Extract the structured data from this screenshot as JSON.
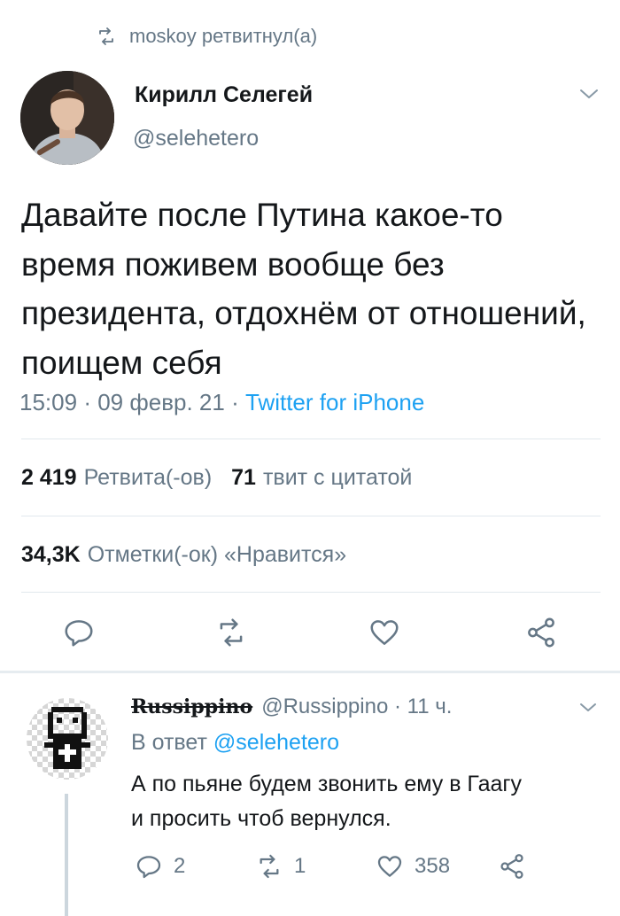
{
  "retweet_context": {
    "text": "moskoy ретвитнул(а)",
    "icon": "retweet-icon"
  },
  "tweet": {
    "author_name": "Кирилл Селегей",
    "author_handle": "@selehetero",
    "text": "Давайте после Путина какое-то время поживем вообще без президента, отдохнём от отношений, поищем себя",
    "time": "15:09",
    "date": "09 февр. 21",
    "source": "Twitter for iPhone",
    "retweets_count": "2 419",
    "retweets_label": "Ретвита(-ов)",
    "quotes_count": "71",
    "quotes_label": "твит с цитатой",
    "likes_count": "34,3K",
    "likes_label": "Отметки(-ок) «Нравится»",
    "actions": [
      "reply-icon",
      "retweet-icon",
      "like-icon",
      "share-icon"
    ]
  },
  "reply": {
    "author_name": "Russippino",
    "author_handle": "@Russippino",
    "time_ago": "11 ч.",
    "reply_prefix": "В ответ",
    "reply_to": "@selehetero",
    "text_line1": "А по пьяне будем звонить ему в Гаагу",
    "text_line2": "и просить чтоб вернулся.",
    "replies_count": "2",
    "retweets_count": "1",
    "likes_count": "358"
  },
  "colors": {
    "link": "#1da1f2",
    "muted": "#657786",
    "divider": "#e1e8ed"
  }
}
